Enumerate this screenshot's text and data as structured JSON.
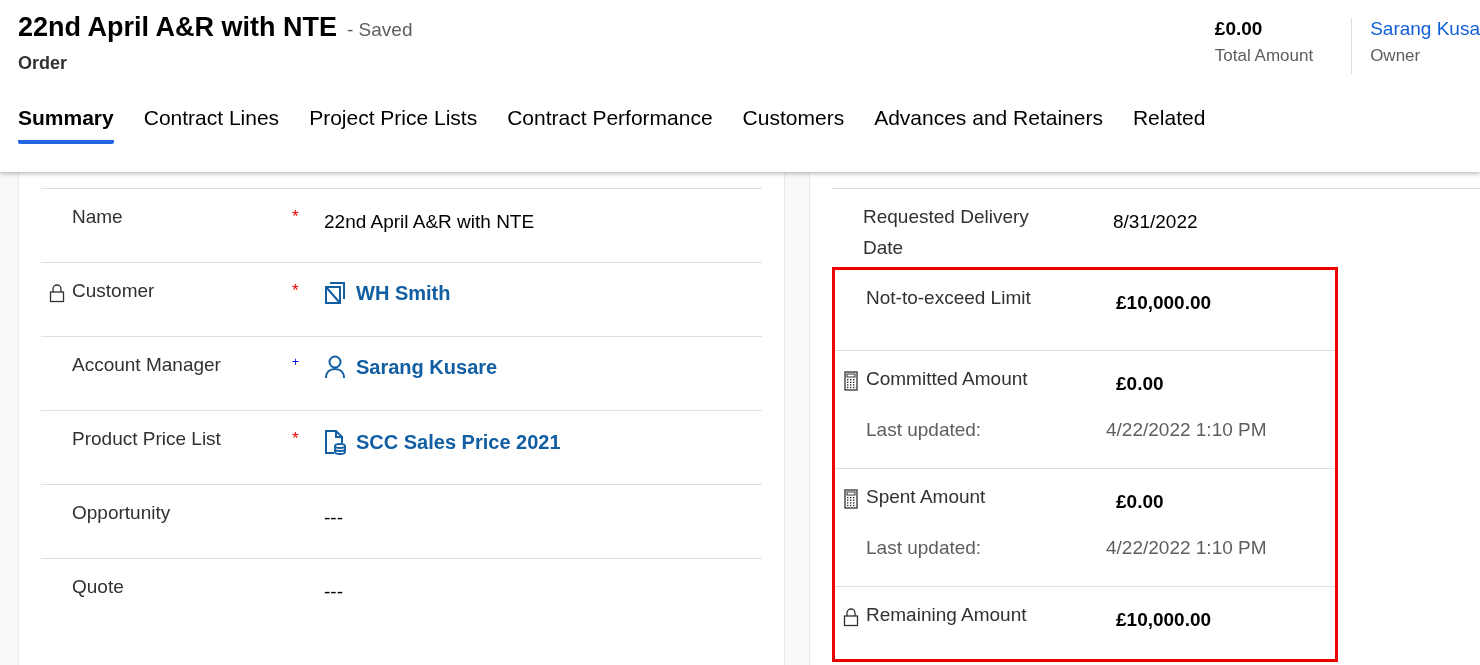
{
  "header": {
    "title": "22nd April A&R with NTE",
    "status": "- Saved",
    "entity": "Order",
    "summary": [
      {
        "kind": "amount",
        "value": "£0.00",
        "label": "Total Amount"
      },
      {
        "kind": "link",
        "value": "Sarang Kusa",
        "label": "Owner"
      }
    ]
  },
  "tabs": [
    {
      "label": "Summary",
      "selected": true
    },
    {
      "label": "Contract Lines",
      "selected": false
    },
    {
      "label": "Project Price Lists",
      "selected": false
    },
    {
      "label": "Contract Performance",
      "selected": false
    },
    {
      "label": "Customers",
      "selected": false
    },
    {
      "label": "Advances and Retainers",
      "selected": false
    },
    {
      "label": "Related",
      "selected": false
    }
  ],
  "left_fields": [
    {
      "label": "Name",
      "locked": false,
      "marker": {
        "kind": "required",
        "text": "*"
      },
      "value": "22nd April A&R with NTE",
      "kind": "text"
    },
    {
      "label": "Customer",
      "locked": true,
      "marker": {
        "kind": "required",
        "text": "*"
      },
      "value": "WH Smith",
      "kind": "account"
    },
    {
      "label": "Account Manager",
      "locked": false,
      "marker": {
        "kind": "recommended",
        "text": "+"
      },
      "value": "Sarang Kusare",
      "kind": "user"
    },
    {
      "label": "Product Price List",
      "locked": false,
      "marker": {
        "kind": "required",
        "text": "*"
      },
      "value": "SCC Sales Price 2021",
      "kind": "pricelist"
    },
    {
      "label": "Opportunity",
      "locked": false,
      "value": "---",
      "kind": "text"
    },
    {
      "label": "Quote",
      "locked": false,
      "value": "---",
      "kind": "text"
    }
  ],
  "right_fields": [
    {
      "label": "Requested Delivery Date",
      "kind": "plain",
      "value": "8/31/2022",
      "highlighted": false
    },
    {
      "label": "Not-to-exceed Limit",
      "kind": "plain",
      "value": "£10,000.00",
      "highlighted": true
    },
    {
      "label": "Committed Amount",
      "kind": "calculated",
      "value": "£0.00",
      "highlighted": true,
      "updated_label": "Last updated:",
      "updated_value": "4/22/2022 1:10 PM"
    },
    {
      "label": "Spent Amount",
      "kind": "calculated",
      "value": "£0.00",
      "highlighted": true,
      "updated_label": "Last updated:",
      "updated_value": "4/22/2022 1:10 PM"
    },
    {
      "label": "Remaining Amount",
      "kind": "locked",
      "value": "£10,000.00",
      "highlighted": true
    }
  ]
}
